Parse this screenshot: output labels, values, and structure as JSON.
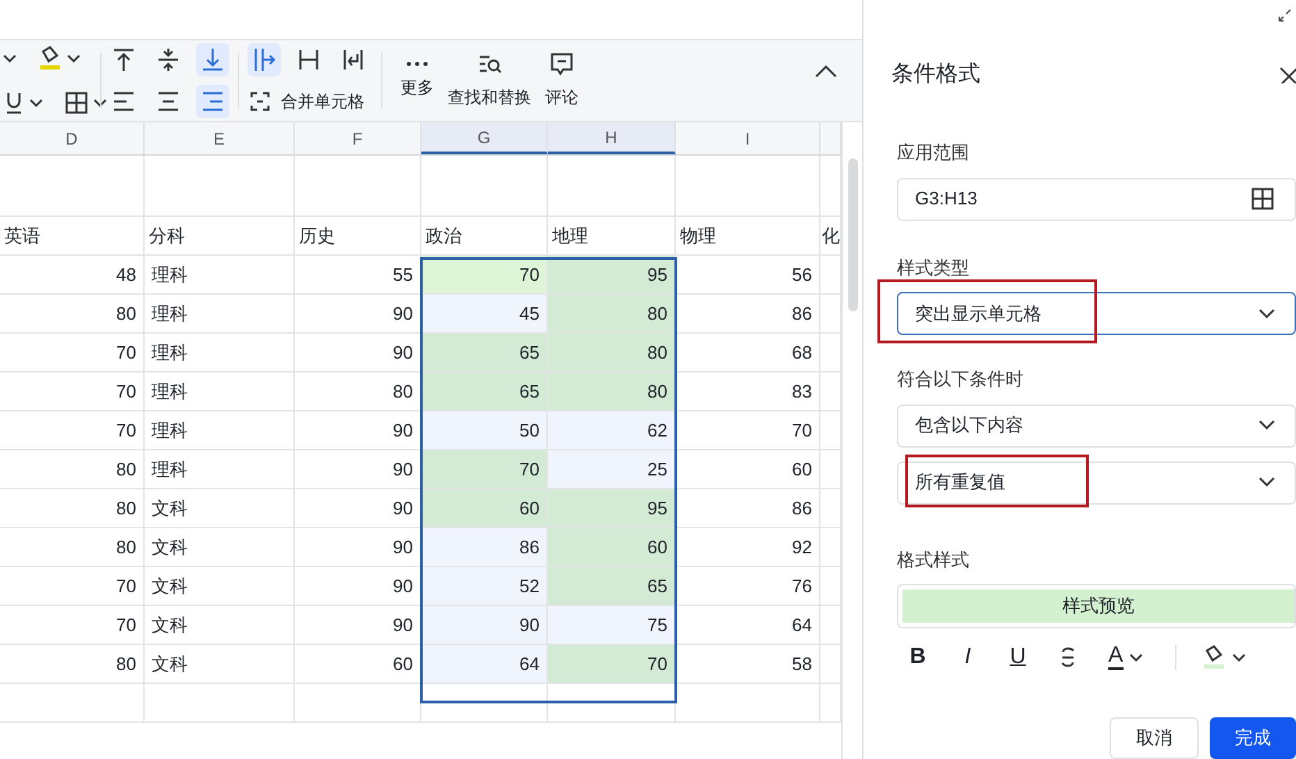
{
  "toolbar": {
    "left_buttons": [
      {
        "kind": "caret"
      },
      {
        "kind": "fill"
      },
      {
        "kind": "underline"
      },
      {
        "kind": "borders"
      }
    ],
    "align_buttons": [
      {
        "kind": "top",
        "selected": false
      },
      {
        "kind": "middle",
        "selected": false
      },
      {
        "kind": "bottom",
        "selected": true
      },
      {
        "kind": "left",
        "selected": false
      },
      {
        "kind": "center",
        "selected": false
      },
      {
        "kind": "right",
        "selected": true
      }
    ],
    "wrap_buttons": [
      {
        "kind": "overflow",
        "selected": true
      },
      {
        "kind": "clip",
        "selected": false
      },
      {
        "kind": "wrap",
        "selected": false
      }
    ],
    "merge_button": {
      "label": "合并单元格"
    },
    "actions": [
      {
        "kind": "more",
        "label": "更多"
      },
      {
        "kind": "find",
        "label": "查找和替换"
      },
      {
        "kind": "comment",
        "label": "评论"
      }
    ]
  },
  "sheet": {
    "columns": [
      {
        "label": "D",
        "selected": false
      },
      {
        "label": "E",
        "selected": false
      },
      {
        "label": "F",
        "selected": false
      },
      {
        "label": "G",
        "selected": true
      },
      {
        "label": "H",
        "selected": true
      },
      {
        "label": "I",
        "selected": false
      }
    ],
    "header_row": [
      "英语",
      "分科",
      "历史",
      "政治",
      "地理",
      "物理",
      "化"
    ],
    "rows": [
      {
        "cells": [
          "48",
          "理科",
          "55",
          "70",
          "95",
          "56"
        ],
        "g_active": true,
        "g_duplicate": true,
        "h_duplicate": true
      },
      {
        "cells": [
          "80",
          "理科",
          "90",
          "45",
          "80",
          "86"
        ],
        "g_active": false,
        "g_duplicate": false,
        "h_duplicate": true
      },
      {
        "cells": [
          "70",
          "理科",
          "90",
          "65",
          "80",
          "68"
        ],
        "g_active": false,
        "g_duplicate": true,
        "h_duplicate": true
      },
      {
        "cells": [
          "70",
          "理科",
          "80",
          "65",
          "80",
          "83"
        ],
        "g_active": false,
        "g_duplicate": true,
        "h_duplicate": true
      },
      {
        "cells": [
          "70",
          "理科",
          "90",
          "50",
          "62",
          "70"
        ],
        "g_active": false,
        "g_duplicate": false,
        "h_duplicate": false
      },
      {
        "cells": [
          "80",
          "理科",
          "90",
          "70",
          "25",
          "60"
        ],
        "g_active": false,
        "g_duplicate": true,
        "h_duplicate": false
      },
      {
        "cells": [
          "80",
          "文科",
          "90",
          "60",
          "95",
          "86"
        ],
        "g_active": false,
        "g_duplicate": true,
        "h_duplicate": true
      },
      {
        "cells": [
          "80",
          "文科",
          "90",
          "86",
          "60",
          "92"
        ],
        "g_active": false,
        "g_duplicate": false,
        "h_duplicate": true
      },
      {
        "cells": [
          "70",
          "文科",
          "90",
          "52",
          "65",
          "76"
        ],
        "g_active": false,
        "g_duplicate": false,
        "h_duplicate": true
      },
      {
        "cells": [
          "70",
          "文科",
          "90",
          "90",
          "75",
          "64"
        ],
        "g_active": false,
        "g_duplicate": false,
        "h_duplicate": false
      },
      {
        "cells": [
          "80",
          "文科",
          "60",
          "64",
          "70",
          "58"
        ],
        "g_active": false,
        "g_duplicate": false,
        "h_duplicate": true
      }
    ]
  },
  "panel": {
    "title": "条件格式",
    "range": {
      "label": "应用范围",
      "value": "G3:H13"
    },
    "style_type": {
      "label": "样式类型",
      "value": "突出显示单元格",
      "annotated": true
    },
    "condition": {
      "label": "符合以下条件时",
      "rule": {
        "value": "包含以下内容",
        "annotated": false
      },
      "detail": {
        "value": "所有重复值",
        "annotated": true
      }
    },
    "format": {
      "label": "格式样式",
      "preview": "样式预览",
      "tools": [
        {
          "kind": "bold",
          "label": "B"
        },
        {
          "kind": "italic",
          "label": "I"
        },
        {
          "kind": "underline",
          "label": "U"
        },
        {
          "kind": "strike"
        },
        {
          "kind": "color",
          "label": "A"
        },
        {
          "kind": "fill"
        }
      ]
    },
    "buttons": [
      {
        "label": "取消",
        "primary": false
      },
      {
        "label": "完成",
        "primary": true
      }
    ]
  }
}
